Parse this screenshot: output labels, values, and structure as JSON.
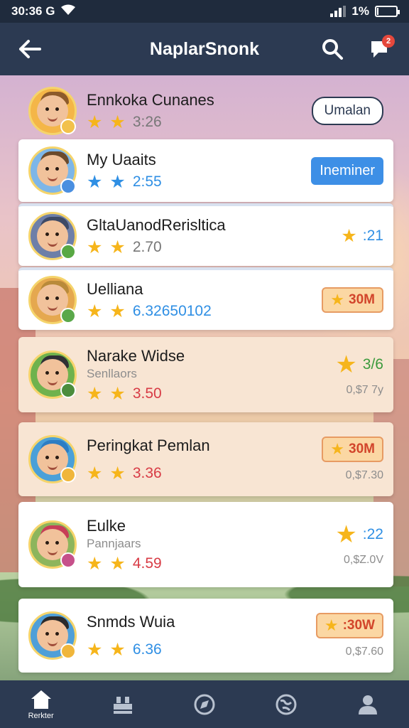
{
  "status_bar": {
    "time": "30:36 G",
    "battery": "1%"
  },
  "app_bar": {
    "title": "NaplarSnonk"
  },
  "colors": {
    "bar": "#2c3a52",
    "accent_blue": "#3d8fe6",
    "star": "#f6b51b"
  },
  "rows": [
    {
      "name": "Ennkoka Cunanes",
      "score": "3:26",
      "action": "Umalan"
    },
    {
      "name": "My Uaaits",
      "score": "2:55",
      "action": "Ineminer"
    },
    {
      "name": "GltaUanodRerisltica",
      "score": "2.70",
      "right_value": ":21"
    },
    {
      "name": "Uelliana",
      "score": "6.32650102",
      "right_value": "30M"
    },
    {
      "name": "Narake Widse",
      "subtitle": "Senllaors",
      "score": "3.50",
      "right_value": "3/6",
      "extra": "0,$7 7y"
    },
    {
      "name": "Peringkat Pemlan",
      "score": "3.36",
      "right_value": "30M",
      "extra": "0,$7.30"
    },
    {
      "name": "Eulke",
      "subtitle": "Pannjaars",
      "score": "4.59",
      "right_value": ":22",
      "extra": "0,$Z.0V"
    },
    {
      "name": "Snmds Wuia",
      "score": "6.36",
      "right_value": ":30W",
      "extra": "0,$7.60"
    }
  ],
  "bottom_nav": {
    "home_label": "Rerkter"
  },
  "icons": {
    "back": "arrow-left-icon",
    "search": "search-icon",
    "notifications": "chat-bell-icon",
    "nav": [
      "home-icon",
      "cards-icon",
      "compass-icon",
      "globe-icon",
      "profile-icon"
    ]
  },
  "notification_count": "2"
}
